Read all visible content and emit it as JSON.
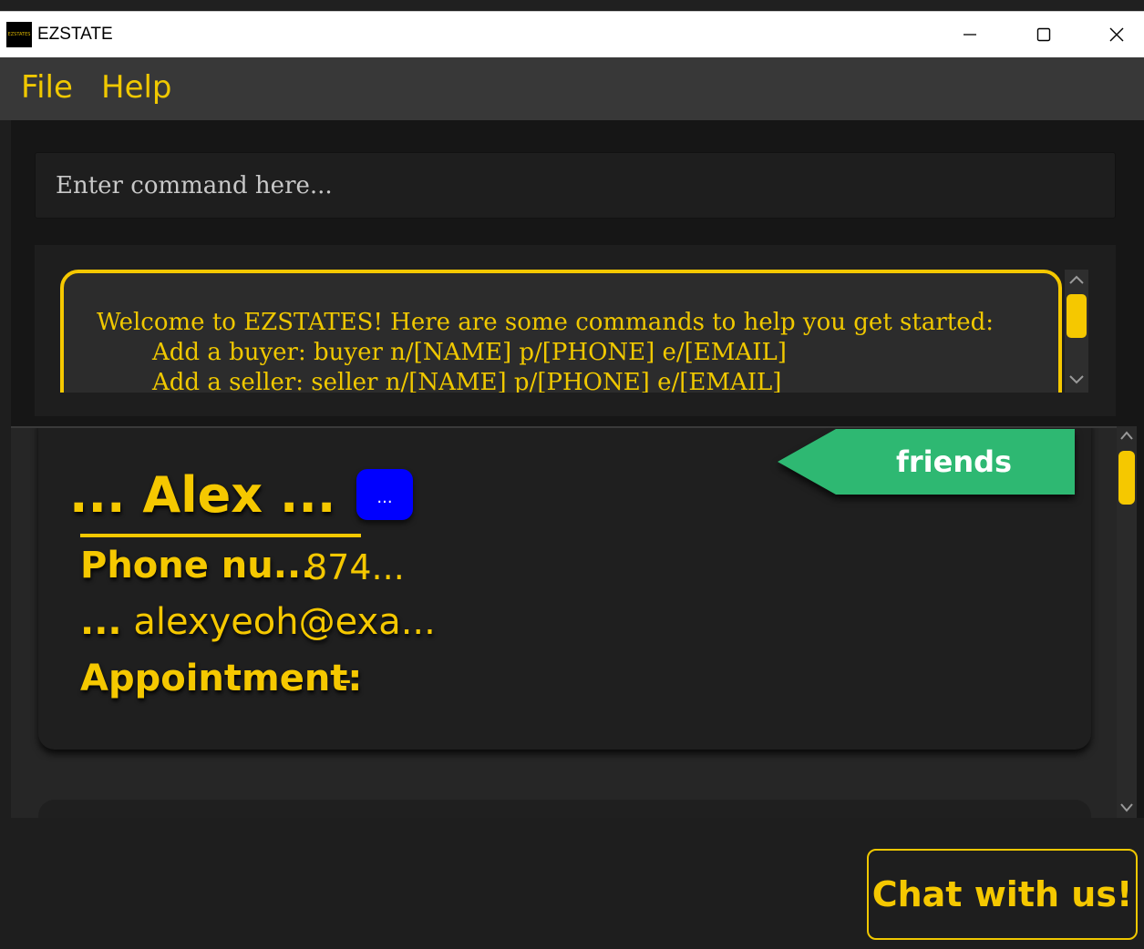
{
  "window": {
    "title": "EZSTATE",
    "icon_text": "EZSTATES"
  },
  "menu": {
    "items": [
      {
        "label": "File"
      },
      {
        "label": "Help"
      }
    ]
  },
  "command": {
    "placeholder": "Enter command here..."
  },
  "result": {
    "lines": [
      "Welcome to EZSTATES! Here are some commands to help you get started:",
      "Add a buyer: buyer n/[NAME] p/[PHONE] e/[EMAIL]",
      "Add a seller: seller n/[NAME] p/[PHONE] e/[EMAIL]"
    ]
  },
  "client_card": {
    "name": "... Alex ...",
    "id_badge": "...",
    "phone_label": "Phone nu...",
    "phone_value": "874...",
    "email_prefix": "...",
    "email_value": "alexyeoh@exa...",
    "appointment_label": "Appointment:",
    "appointment_value": "-",
    "tag": "friends"
  },
  "chat_button": {
    "label": "Chat with us!"
  },
  "colors": {
    "accent": "#f5c800",
    "tag": "#2eb872",
    "badge": "#0000ff",
    "background": "#1e1e1e"
  },
  "icons": {
    "minimize": "minimize-icon",
    "maximize": "maximize-icon",
    "close": "close-icon"
  }
}
